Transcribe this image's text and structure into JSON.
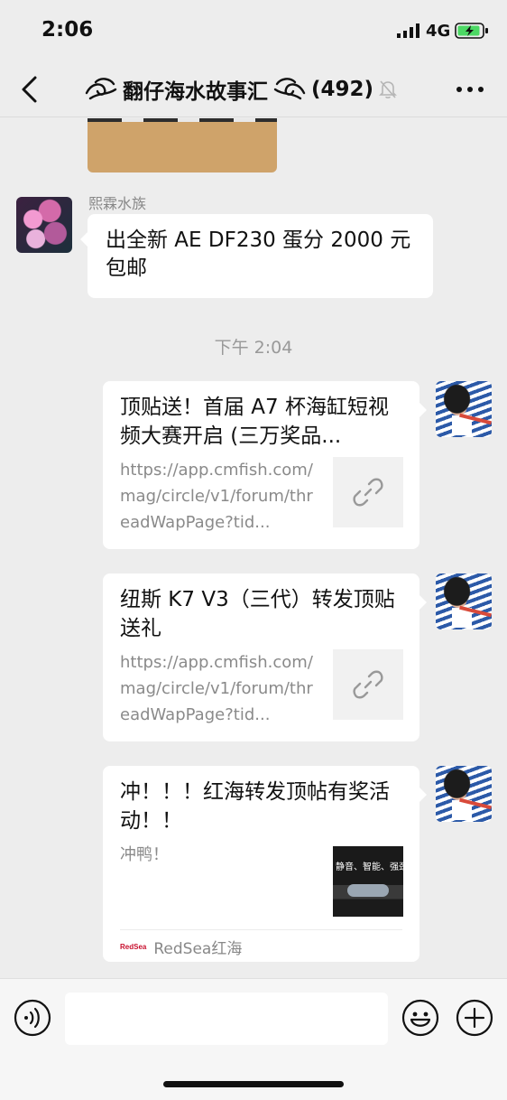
{
  "status_bar": {
    "time": "2:06",
    "network": "4G"
  },
  "header": {
    "title": "翻仔海水故事汇",
    "member_count": "(492)",
    "icons": [
      "back-icon",
      "wave-icon",
      "mute-bell-icon",
      "more-icon"
    ]
  },
  "messages": {
    "sender_name": "熙霖水族",
    "text": "出全新 AE DF230 蛋分 2000 元包邮",
    "timestamp": "下午 2:04",
    "cards": [
      {
        "title": "顶贴送！首届 A7 杯海缸短视频大赛开启 (三万奖品...",
        "url": "https://app.cmfish.com/mag/circle/v1/forum/threadWapPage?tid...",
        "thumb_icon": "link-icon"
      },
      {
        "title": "纽斯 K7 V3（三代）转发顶贴送礼",
        "url": "https://app.cmfish.com/mag/circle/v1/forum/threadWapPage?tid...",
        "thumb_icon": "link-icon"
      },
      {
        "title": "冲！！！红海转发顶帖有奖活动！！",
        "description": "冲鸭！",
        "thumb_caption": "静音、智能、强劲",
        "source_logo": "RedSea",
        "source_name": "RedSea红海"
      }
    ]
  },
  "input_bar": {
    "placeholder": "",
    "icons": [
      "voice-icon",
      "emoji-icon",
      "plus-icon"
    ]
  },
  "colors": {
    "background": "#ededed",
    "bubble": "#ffffff",
    "muted_text": "#888888",
    "battery_green": "#4cd964"
  }
}
